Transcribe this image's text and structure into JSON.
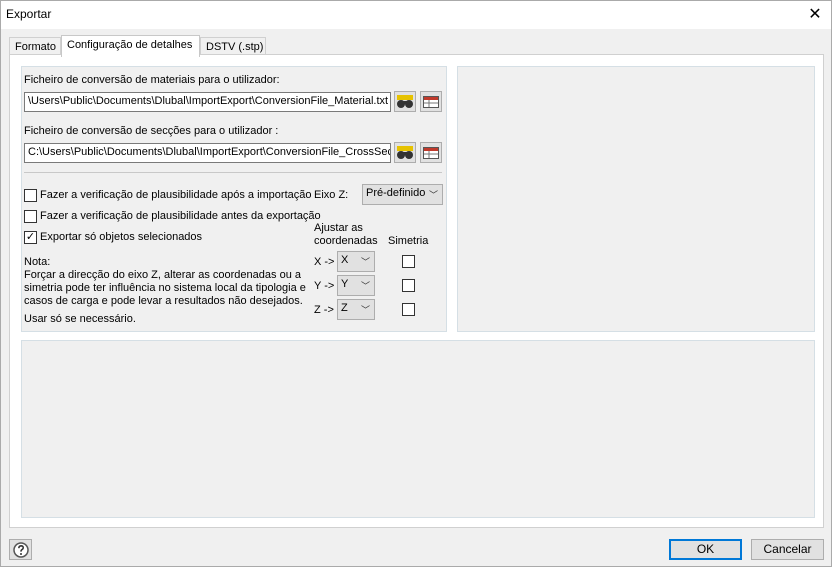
{
  "window": {
    "title": "Exportar"
  },
  "tabs": [
    {
      "label": "Formato"
    },
    {
      "label": "Configuração de detalhes"
    },
    {
      "label": "DSTV (.stp)"
    }
  ],
  "material_file": {
    "label": "Ficheiro de conversão de materiais para o utilizador:",
    "value": "\\Users\\Public\\Documents\\Dlubal\\ImportExport\\ConversionFile_Material.txt"
  },
  "section_file": {
    "label": "Ficheiro de conversão de secções para o utilizador :",
    "value": "C:\\Users\\Public\\Documents\\Dlubal\\ImportExport\\ConversionFile_CrossSect"
  },
  "options": {
    "check_after_import": {
      "label": "Fazer a verificação de plausibilidade após a importação",
      "checked": false
    },
    "check_before_export": {
      "label": "Fazer a verificação de plausibilidade antes da exportação",
      "checked": false
    },
    "export_selected_only": {
      "label": "Exportar só objetos selecionados",
      "checked": true,
      "mark": "✓"
    }
  },
  "z_axis": {
    "label": "Eixo Z:",
    "value": "Pré-definido"
  },
  "coords": {
    "header_adjust_1": "Ajustar as",
    "header_adjust_2": "coordenadas",
    "header_symmetry": "Simetria",
    "rows": [
      {
        "label": "X ->",
        "value": "X"
      },
      {
        "label": "Y ->",
        "value": "Y"
      },
      {
        "label": "Z ->",
        "value": "Z"
      }
    ]
  },
  "note": {
    "title": "Nota:",
    "line1": "Forçar a direcção do eixo Z, alterar as coordenadas ou a",
    "line2": "simetria pode ter influência no sistema local da tipologia e",
    "line3": "casos de carga e pode levar a resultados não desejados.",
    "line4": "Usar só se necessário."
  },
  "buttons": {
    "ok": "OK",
    "cancel": "Cancelar"
  }
}
